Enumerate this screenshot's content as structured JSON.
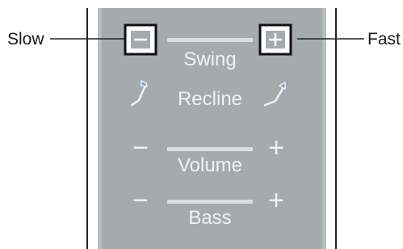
{
  "callouts": {
    "left": "Slow",
    "right": "Fast"
  },
  "controls": {
    "swing": {
      "label": "Swing",
      "decrease_icon": "minus-square-icon",
      "increase_icon": "plus-square-icon"
    },
    "recline": {
      "label": "Recline",
      "back_icon": "recline-back-arrow-icon",
      "forward_icon": "recline-forward-arrow-icon"
    },
    "volume": {
      "label": "Volume",
      "decrease_glyph": "−",
      "increase_glyph": "+"
    },
    "bass": {
      "label": "Bass",
      "decrease_glyph": "−",
      "increase_glyph": "+"
    }
  },
  "colors": {
    "panel_fill": "#a5aaad",
    "panel_edge": "#b9bdbf",
    "glyph": "#f2f2f2",
    "outline": "#1a1a1a"
  }
}
